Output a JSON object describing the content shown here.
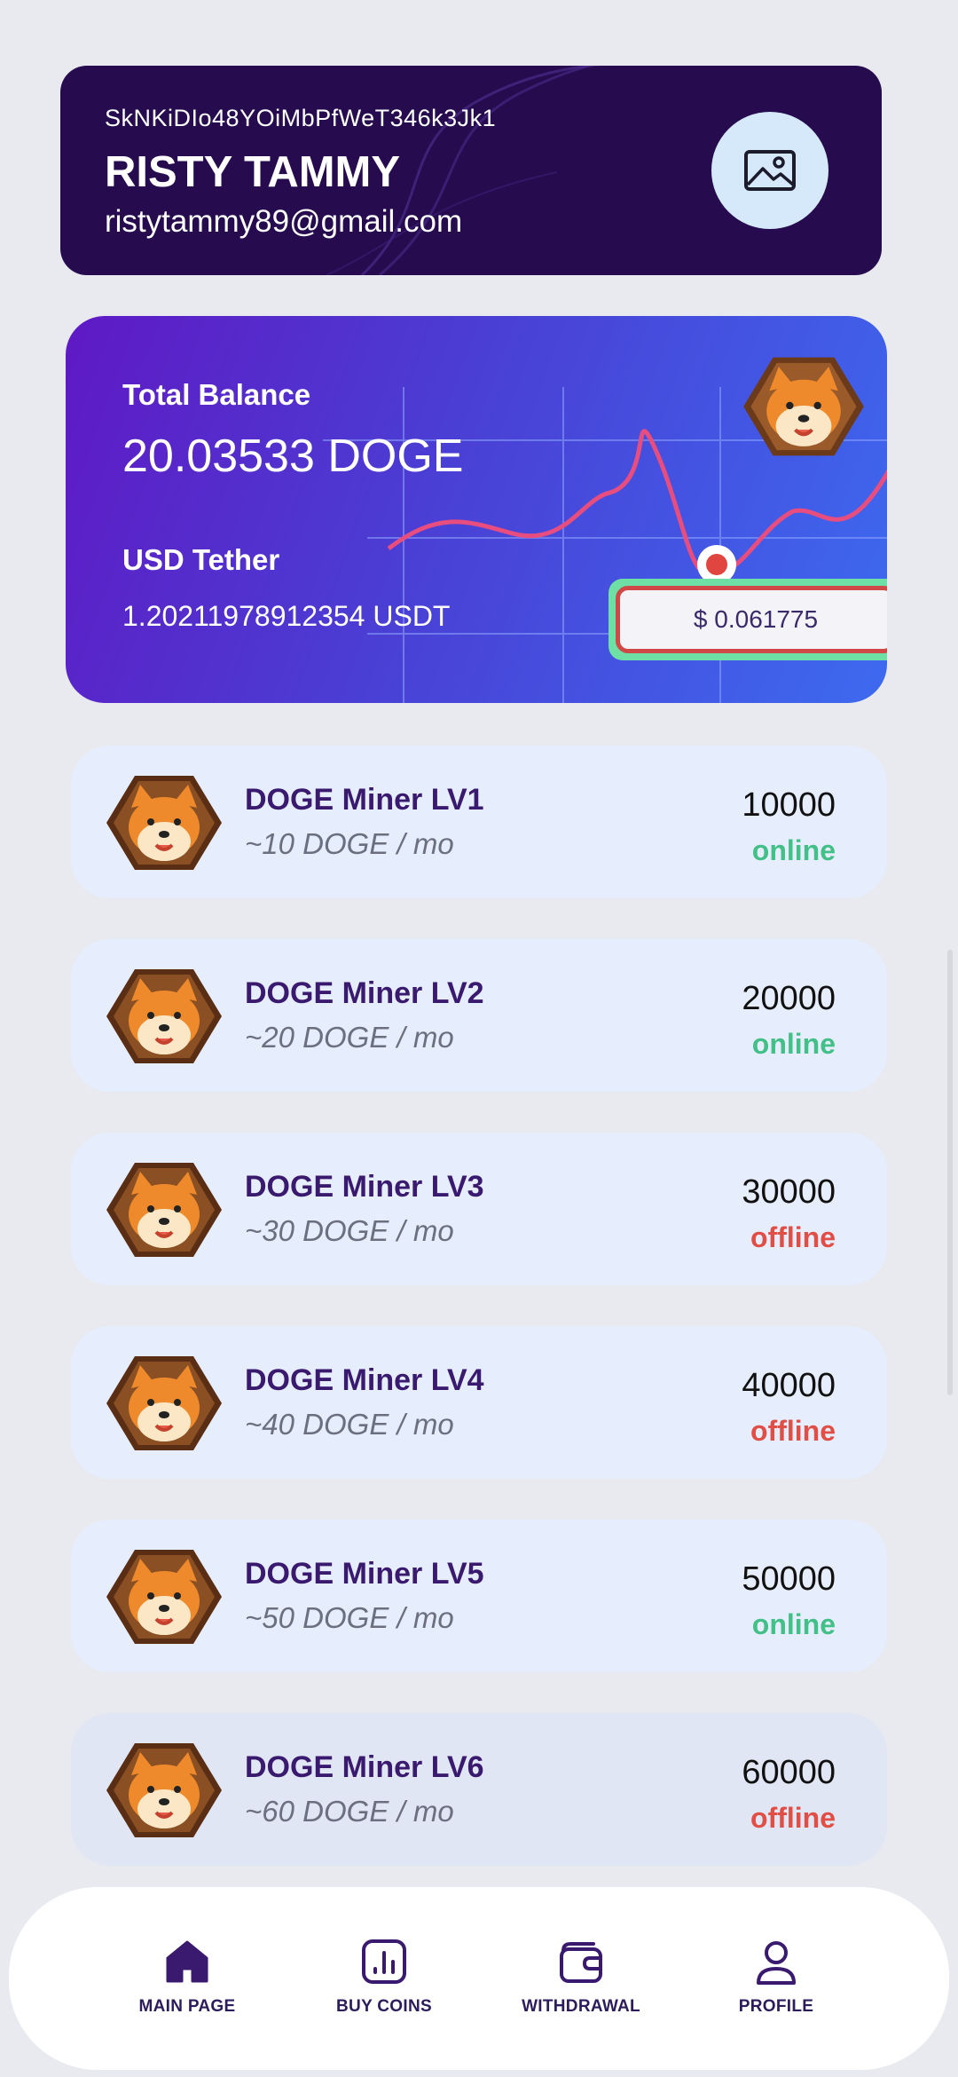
{
  "profile": {
    "id": "SkNKiDIo48YOiMbPfWeT346k3Jk1",
    "name": "RISTY TAMMY",
    "email": "ristytammy89@gmail.com",
    "avatar_icon": "image-placeholder-icon"
  },
  "balance": {
    "total_label": "Total Balance",
    "total_value": "20.03533 DOGE",
    "usd_label": "USD Tether",
    "usd_value": "1.20211978912354 USDT",
    "price": "$ 0.061775"
  },
  "miners": [
    {
      "title": "DOGE Miner LV1",
      "rate": "~10 DOGE / mo",
      "price": "10000",
      "status": "online"
    },
    {
      "title": "DOGE Miner LV2",
      "rate": "~20 DOGE / mo",
      "price": "20000",
      "status": "online"
    },
    {
      "title": "DOGE Miner LV3",
      "rate": "~30 DOGE / mo",
      "price": "30000",
      "status": "offline"
    },
    {
      "title": "DOGE Miner LV4",
      "rate": "~40 DOGE / mo",
      "price": "40000",
      "status": "offline"
    },
    {
      "title": "DOGE Miner LV5",
      "rate": "~50 DOGE / mo",
      "price": "50000",
      "status": "online"
    },
    {
      "title": "DOGE Miner LV6",
      "rate": "~60 DOGE / mo",
      "price": "60000",
      "status": "offline"
    }
  ],
  "nav": {
    "items": [
      {
        "label": "MAIN PAGE",
        "icon": "home-icon",
        "active": true
      },
      {
        "label": "BUY COINS",
        "icon": "chart-icon",
        "active": false
      },
      {
        "label": "WITHDRAWAL",
        "icon": "wallet-icon",
        "active": false
      },
      {
        "label": "PROFILE",
        "icon": "user-icon",
        "active": false
      }
    ]
  },
  "colors": {
    "profile_bg": "#260c4e",
    "online": "#43bf88",
    "offline": "#e04e45",
    "nav_active": "#3a1a6e"
  }
}
